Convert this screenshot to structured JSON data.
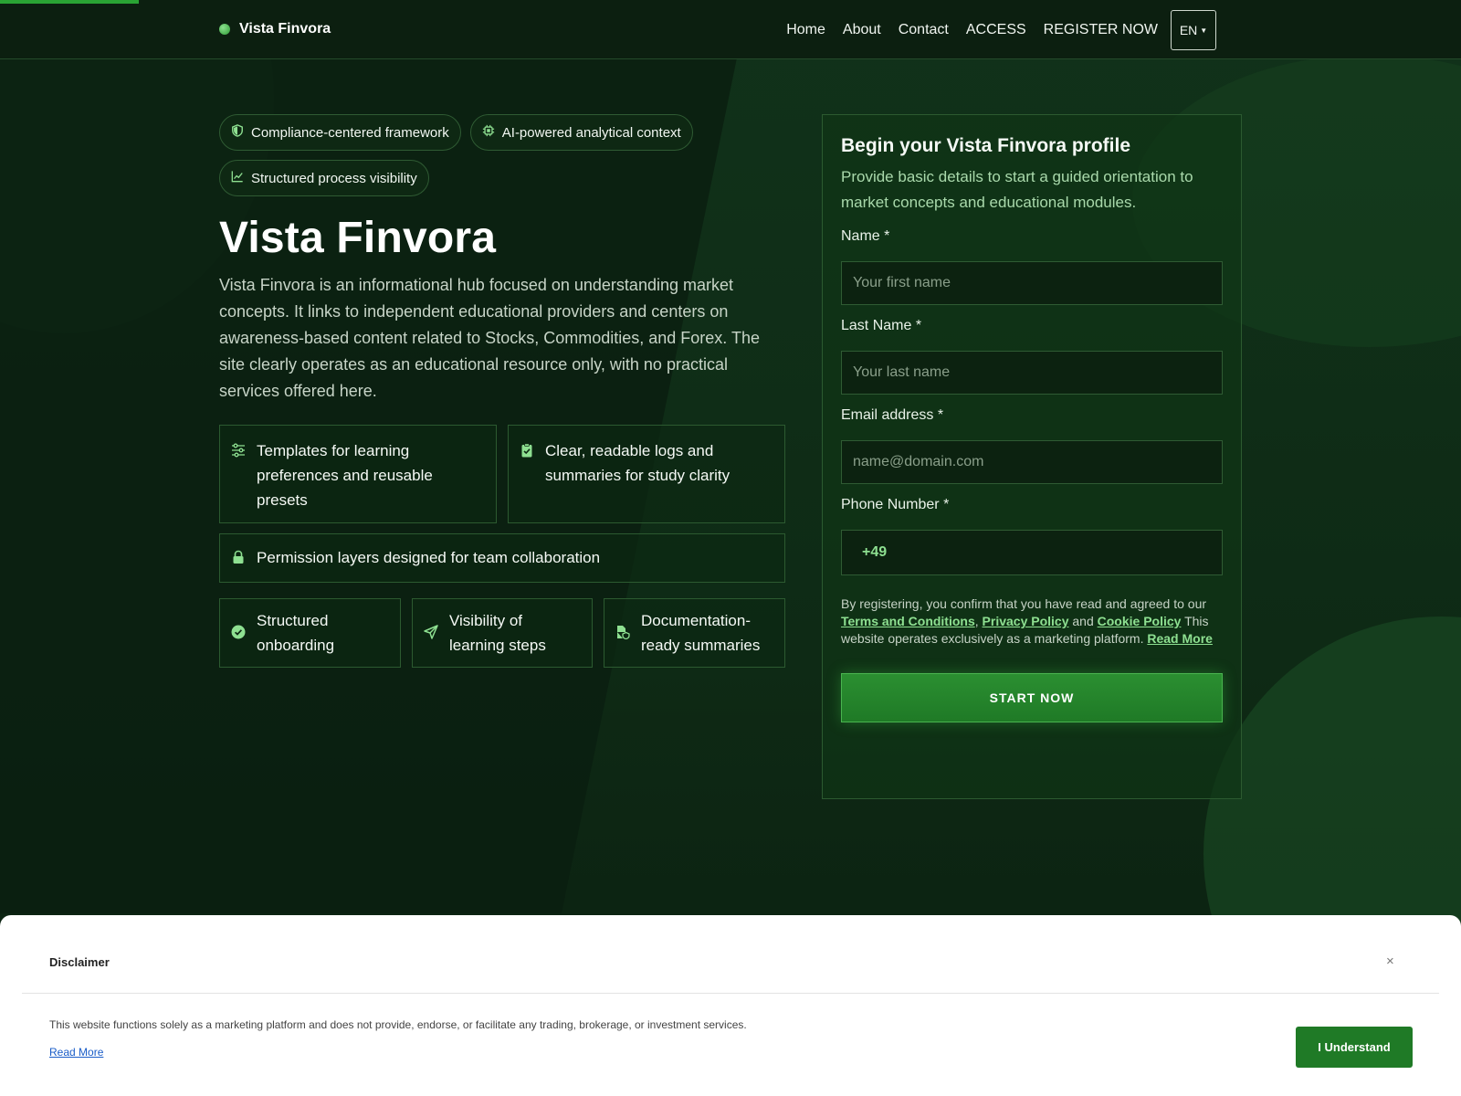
{
  "brand": {
    "name": "Vista Finvora"
  },
  "nav": {
    "items": [
      "Home",
      "About",
      "Contact",
      "ACCESS",
      "REGISTER NOW"
    ],
    "language": "EN"
  },
  "hero": {
    "pills": [
      {
        "label": "Compliance-centered framework",
        "icon": "shield-icon"
      },
      {
        "label": "AI-powered analytical context",
        "icon": "chip-icon"
      },
      {
        "label": "Structured process visibility",
        "icon": "trend-chart-icon"
      }
    ],
    "title": "Vista Finvora",
    "description": "Vista Finvora is an informational hub focused on understanding market concepts. It links to independent educational providers and centers on awareness-based content related to Stocks, Commodities, and Forex. The site clearly operates as an educational resource only, with no practical services offered here."
  },
  "features": {
    "row1": [
      {
        "text": "Templates for learning preferences and reusable presets",
        "icon": "sliders-icon"
      },
      {
        "text": "Clear, readable logs and summaries for study clarity",
        "icon": "clipboard-check-icon"
      }
    ],
    "row2": {
      "text": "Permission layers designed for team collaboration",
      "icon": "lock-icon"
    },
    "row3": [
      {
        "text": "Structured onboarding",
        "icon": "check-circle-icon"
      },
      {
        "text": "Visibility of learning steps",
        "icon": "send-arrow-icon"
      },
      {
        "text": "Documentation-ready summaries",
        "icon": "file-shield-icon"
      }
    ]
  },
  "form": {
    "title": "Begin your Vista Finvora profile",
    "subtitle": "Provide basic details to start a guided orientation to market concepts and educational modules.",
    "name_label": "Name *",
    "name_placeholder": "Your first name",
    "lastname_label": "Last Name *",
    "lastname_placeholder": "Your last name",
    "email_label": "Email address *",
    "email_placeholder": "name@domain.com",
    "phone_label": "Phone Number *",
    "phone_prefix": "+49",
    "consent_pre": "By registering, you confirm that you have read and agreed to our ",
    "terms": "Terms and Conditions",
    "comma": ", ",
    "privacy": "Privacy Policy",
    "and": " and ",
    "cookie": "Cookie Policy",
    "consent_post": " This website operates exclusively as a marketing platform. ",
    "read_more": "Read More",
    "submit": "START NOW"
  },
  "disclaimer": {
    "title": "Disclaimer",
    "close": "×",
    "text": "This website functions solely as a marketing platform and does not provide, endorse, or facilitate any trading, brokerage, or investment services.",
    "read_more": "Read More",
    "button": "I Understand"
  },
  "colors": {
    "accent": "#2aa334",
    "link_green": "#8ee091",
    "background": "#0e2a15",
    "cta": "#1f7a26"
  }
}
